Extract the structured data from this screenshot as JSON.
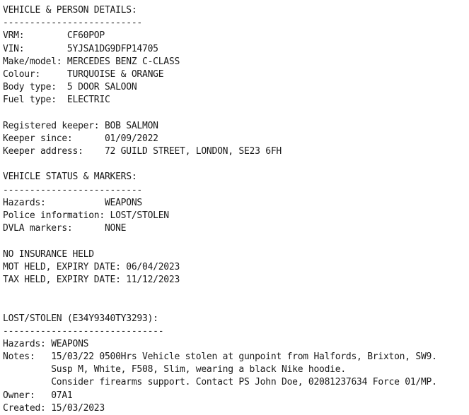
{
  "report": {
    "lines": [
      "VEHICLE & PERSON DETAILS:",
      "--------------------------",
      "VRM:        CF60POP",
      "VIN:        5YJSA1DG9DFP14705",
      "Make/model: MERCEDES BENZ C-CLASS",
      "Colour:     TURQUOISE & ORANGE",
      "Body type:  5 DOOR SALOON",
      "Fuel type:  ELECTRIC",
      "",
      "Registered keeper: BOB SALMON",
      "Keeper since:      01/09/2022",
      "Keeper address:    72 GUILD STREET, LONDON, SE23 6FH",
      "",
      "VEHICLE STATUS & MARKERS:",
      "--------------------------",
      "Hazards:           WEAPONS",
      "Police information: LOST/STOLEN",
      "DVLA markers:      NONE",
      "",
      "NO INSURANCE HELD",
      "MOT HELD, EXPIRY DATE: 06/04/2023",
      "TAX HELD, EXPIRY DATE: 11/12/2023",
      "",
      "",
      "LOST/STOLEN (E34Y9340TY3293):",
      "------------------------------",
      "Hazards: WEAPONS",
      "Notes:   15/03/22 0500Hrs Vehicle stolen at gunpoint from Halfords, Brixton, SW9.",
      "         Susp M, White, F508, Slim, wearing a black Nike hoodie.",
      "         Consider firearms support. Contact PS John Doe, 02081237634 Force 01/MP.",
      "Owner:   07A1",
      "Created: 15/03/2023"
    ]
  }
}
